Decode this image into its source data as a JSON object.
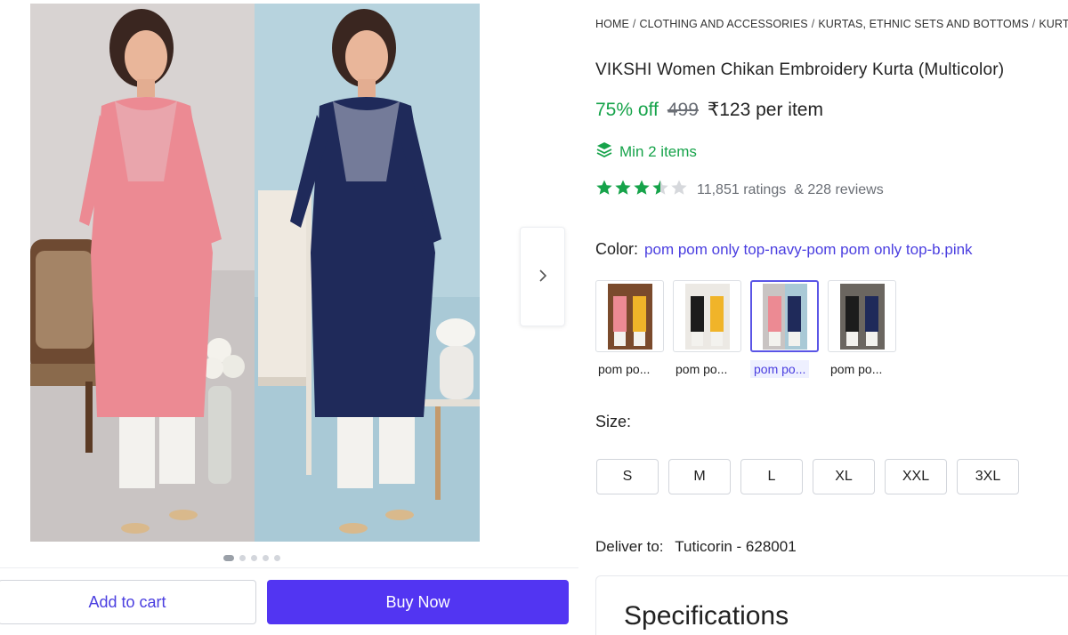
{
  "breadcrumb": {
    "items": [
      "HOME",
      "CLOTHING AND ACCESSORIES",
      "KURTAS, ETHNIC SETS AND BOTTOMS",
      "KURTA"
    ],
    "separator": "/"
  },
  "product": {
    "title": "VIKSHI Women Chikan Embroidery Kurta (Multicolor)",
    "discount": "75% off",
    "mrp": "499",
    "price": "₹123 per item",
    "min_items": "Min 2 items",
    "rating_value": 3.5,
    "rating_max": 5,
    "ratings_count": "11,851 ratings",
    "reviews_count": "& 228 reviews"
  },
  "color": {
    "label": "Color:",
    "selected": "pom pom only top-navy-pom pom only top-b.pink",
    "options": [
      {
        "name": "pom po...",
        "selected": false
      },
      {
        "name": "pom po...",
        "selected": false
      },
      {
        "name": "pom po...",
        "selected": true
      },
      {
        "name": "pom po...",
        "selected": false
      }
    ]
  },
  "size": {
    "label": "Size:",
    "options": [
      "S",
      "M",
      "L",
      "XL",
      "XXL",
      "3XL"
    ]
  },
  "delivery": {
    "label": "Deliver to:",
    "location": "Tuticorin - 628001"
  },
  "specifications": {
    "title": "Specifications"
  },
  "gallery": {
    "image_count": 5,
    "active_index": 0,
    "next_icon": "chevron-right-icon"
  },
  "actions": {
    "add_to_cart": "Add to cart",
    "buy_now": "Buy Now"
  },
  "colors": {
    "accent": "#5235f2",
    "link": "#4a3ee0",
    "success": "#16a34a",
    "star": "#16a34a"
  }
}
